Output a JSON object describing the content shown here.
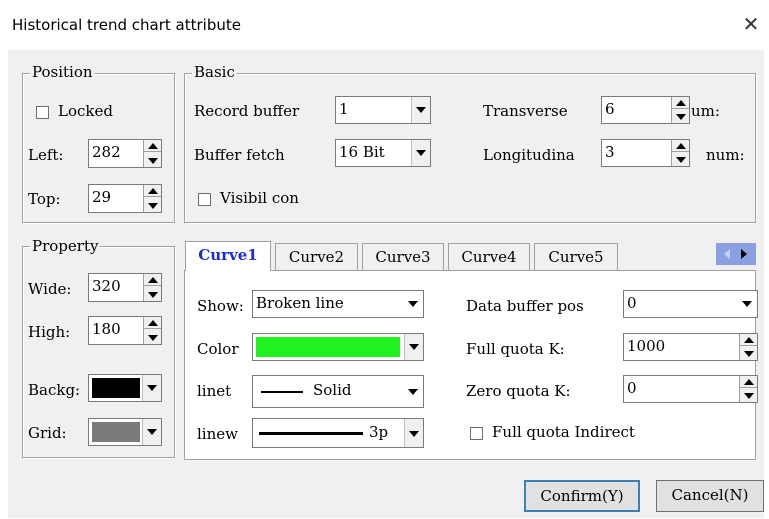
{
  "window": {
    "title": "Historical trend chart attribute"
  },
  "position": {
    "legend": "Position",
    "locked_label": "Locked",
    "left_label": "Left:",
    "left_value": "282",
    "top_label": "Top:",
    "top_value": "29"
  },
  "basic": {
    "legend": "Basic",
    "record_buffer_label": "Record buffer",
    "record_buffer_value": "1",
    "buffer_fetch_label": "Buffer fetch",
    "buffer_fetch_value": "16 Bit",
    "visibil_label": "Visibil con",
    "transverse_label": "Transverse",
    "transverse_value": "6",
    "transverse_unit": "um:",
    "longitudinal_label": "Longitudina",
    "longitudinal_value": "3",
    "longitudinal_unit": "num:"
  },
  "property": {
    "legend": "Property",
    "wide_label": "Wide:",
    "wide_value": "320",
    "high_label": "High:",
    "high_value": "180",
    "backg_label": "Backg:",
    "backg_color": "#000000",
    "grid_label": "Grid:",
    "grid_color": "#7a7a7a"
  },
  "tabs": [
    "Curve1",
    "Curve2",
    "Curve3",
    "Curve4",
    "Curve5"
  ],
  "curve": {
    "show_label": "Show:",
    "show_value": "Broken line",
    "color_label": "Color",
    "color_value": "#1ff21f",
    "linetype_label": "linet",
    "linetype_value": "Solid",
    "linewidth_label": "linew",
    "linewidth_value": "3p",
    "data_buffer_label": "Data buffer pos",
    "data_buffer_value": "0",
    "full_quota_label": "Full quota K:",
    "full_quota_value": "1000",
    "zero_quota_label": "Zero quota K:",
    "zero_quota_value": "0",
    "full_quota_indirect_label": "Full quota Indirect"
  },
  "buttons": {
    "confirm": "Confirm(Y)",
    "cancel": "Cancel(N)"
  }
}
